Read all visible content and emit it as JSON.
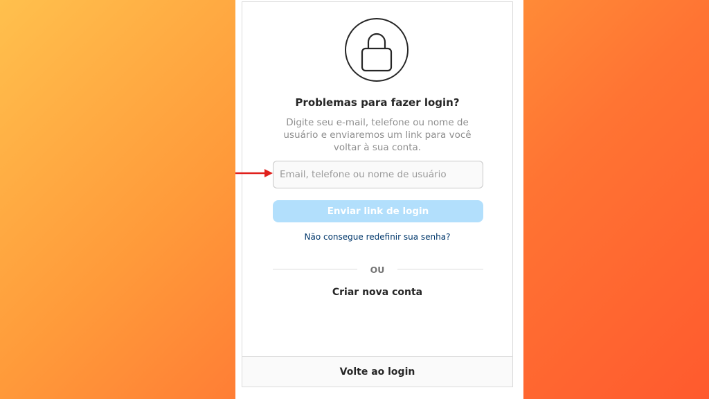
{
  "reset_card": {
    "lock_icon": "lock-icon",
    "title": "Problemas para fazer login?",
    "description": "Digite seu e-mail, telefone ou nome de usuário e enviaremos um link para você voltar à sua conta.",
    "input": {
      "placeholder": "Email, telefone ou nome de usuário",
      "value": ""
    },
    "send_button_label": "Enviar link de login",
    "reset_help_link": "Não consegue redefinir sua senha?",
    "divider_text": "OU",
    "create_account_link": "Criar nova conta",
    "back_to_login_link": "Volte ao login"
  },
  "annotation": {
    "arrow_color": "#e0201c"
  },
  "colors": {
    "send_button_bg": "#b2dffc",
    "link_blue": "#00376b",
    "background_gradient_start": "#ffc04d",
    "background_gradient_end": "#ff5a2e"
  }
}
